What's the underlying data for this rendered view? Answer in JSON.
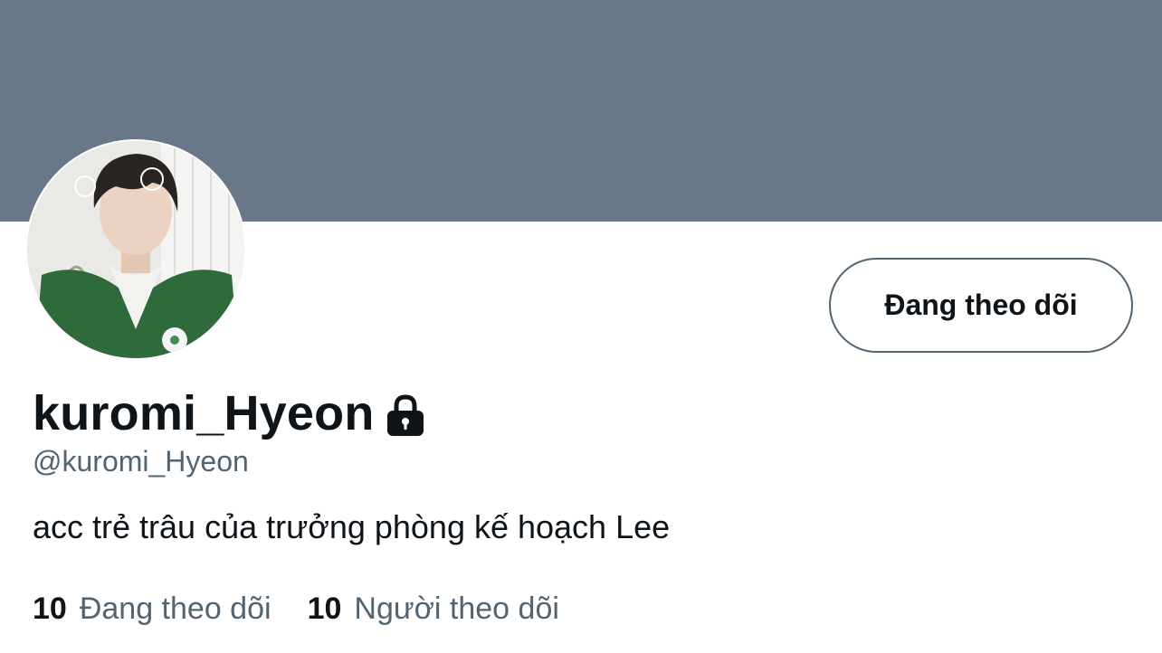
{
  "colors": {
    "banner": "#687888",
    "button_border": "#536471",
    "text_primary": "#0f1419",
    "text_secondary": "#536471"
  },
  "profile": {
    "avatar_icon": "profile-photo",
    "follow_button_label": "Đang theo dõi",
    "display_name": "kuromi_Hyeon",
    "lock_icon": "lock-icon",
    "handle": "@kuromi_Hyeon",
    "bio": "acc trẻ trâu của trưởng phòng kế hoạch Lee",
    "stats": {
      "following_count": "10",
      "following_label": "Đang theo dõi",
      "followers_count": "10",
      "followers_label": "Người theo dõi"
    }
  }
}
